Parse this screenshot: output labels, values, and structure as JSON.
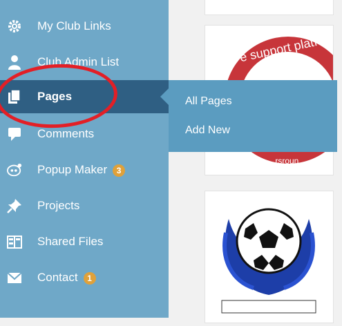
{
  "sidebar": {
    "items": [
      {
        "label": "My Club Links",
        "icon": "gear-icon"
      },
      {
        "label": "Club Admin List",
        "icon": "user-icon"
      },
      {
        "label": "Pages",
        "icon": "pages-icon"
      },
      {
        "label": "Comments",
        "icon": "comment-icon"
      },
      {
        "label": "Popup Maker",
        "icon": "popup-icon",
        "badge": "3"
      },
      {
        "label": "Projects",
        "icon": "pin-icon"
      },
      {
        "label": "Shared Files",
        "icon": "files-icon"
      },
      {
        "label": "Contact",
        "icon": "mail-icon",
        "badge": "1"
      }
    ]
  },
  "flyout": {
    "items": [
      {
        "label": "All Pages"
      },
      {
        "label": "Add New"
      }
    ]
  },
  "colors": {
    "sidebar": "#6fa8c8",
    "active": "#2f5f83",
    "flyout": "#5b9cc0",
    "badge": "#e0a13a",
    "annotation": "#e31f26"
  }
}
